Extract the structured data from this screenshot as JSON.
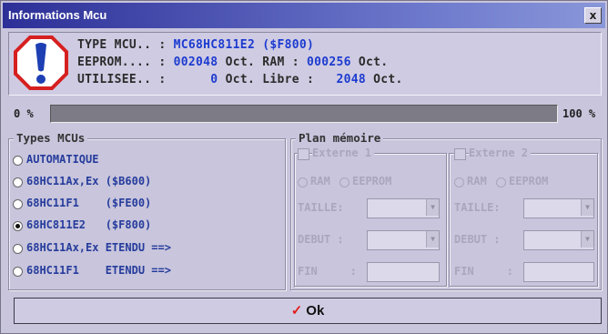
{
  "window": {
    "title": "Informations Mcu",
    "close_label": "x"
  },
  "info": {
    "type_label": "TYPE MCU.. :",
    "type_value": "MC68HC811E2 ($F800)",
    "eeprom_label": "EEPROM.... :",
    "eeprom_value": "002048",
    "eeprom_unit": "Oct.",
    "ram_label": "RAM :",
    "ram_value": "000256",
    "ram_unit": "Oct.",
    "utilisee_label": "UTILISEE.. :",
    "utilisee_value": "0",
    "utilisee_unit": "Oct.",
    "libre_label": "Libre :",
    "libre_value": "2048",
    "libre_unit": "Oct."
  },
  "progress": {
    "min_label": "0 %",
    "max_label": "100 %",
    "value_percent": 100
  },
  "types": {
    "title": "Types MCUs",
    "options": [
      {
        "label": "AUTOMATIQUE",
        "selected": false
      },
      {
        "label": "68HC11Ax,Ex ($B600)",
        "selected": false
      },
      {
        "label": "68HC11F1    ($FE00)",
        "selected": false
      },
      {
        "label": "68HC811E2   ($F800)",
        "selected": true
      },
      {
        "label": "68HC11Ax,Ex ETENDU ==>",
        "selected": false
      },
      {
        "label": "68HC11F1    ETENDU ==>",
        "selected": false
      }
    ]
  },
  "plan": {
    "title": "Plan mémoire",
    "ext1": {
      "label": "Externe 1",
      "ram": "RAM",
      "eeprom": "EEPROM",
      "taille": "TAILLE:",
      "debut": "DEBUT :",
      "fin": "FIN     :"
    },
    "ext2": {
      "label": "Externe 2",
      "ram": "RAM",
      "eeprom": "EEPROM",
      "taille": "TAILLE:",
      "debut": "DEBUT :",
      "fin": "FIN     :"
    }
  },
  "ok": {
    "label": "Ok"
  },
  "colors": {
    "title_start": "#2c2f97",
    "value_blue": "#1c3bd0",
    "check_red": "#e12020"
  }
}
